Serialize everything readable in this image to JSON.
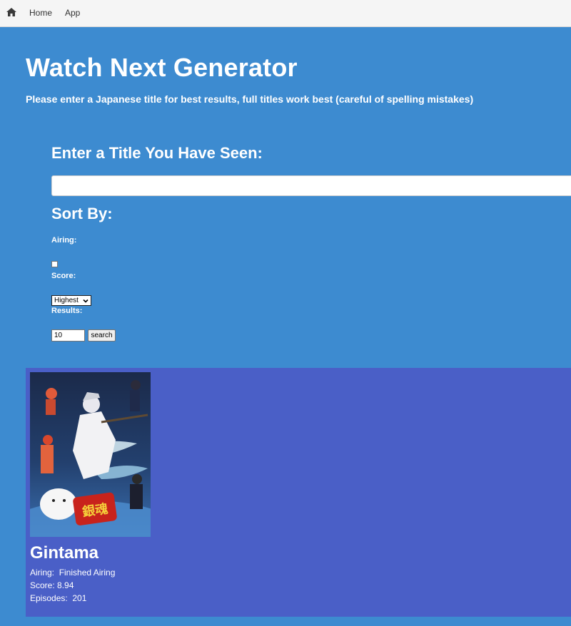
{
  "nav": {
    "home_icon": "home-icon",
    "links": [
      {
        "label": "Home"
      },
      {
        "label": "App"
      }
    ]
  },
  "header": {
    "title": "Watch Next Generator",
    "subtitle": "Please enter a Japanese title for best results, full titles work best (careful of spelling mistakes)"
  },
  "form": {
    "title_prompt": "Enter a Title You Have Seen:",
    "title_value": "",
    "sort_heading": "Sort By:",
    "airing_label": "Airing:",
    "airing_checked": false,
    "score_label": "Score:",
    "score_selected": "Highest",
    "results_label": "Results:",
    "results_value": "10",
    "search_label": "search"
  },
  "results": [
    {
      "title": "Gintama",
      "airing_label": "Airing:",
      "airing_value": "Finished Airing",
      "score_label": "Score:",
      "score_value": "8.94",
      "episodes_label": "Episodes:",
      "episodes_value": "201",
      "cover_logo_text": "銀魂"
    }
  ],
  "colors": {
    "page_bg": "#3d8bd0",
    "results_bg": "#4a5fc7",
    "nav_bg": "#f5f5f5",
    "text": "#ffffff"
  }
}
